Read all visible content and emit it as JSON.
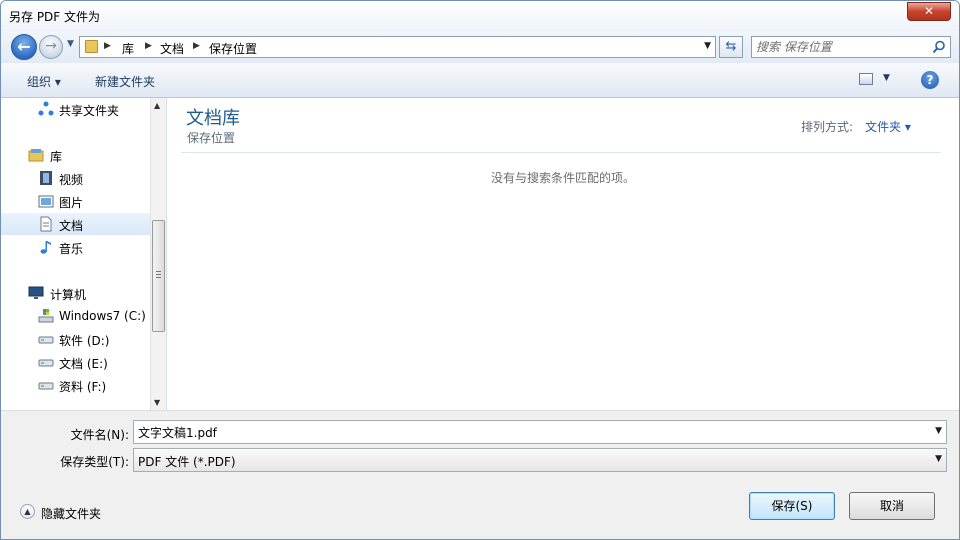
{
  "window": {
    "title": "另存 PDF 文件为",
    "close_label": "✕"
  },
  "nav": {
    "back_icon": "back-arrow-icon",
    "forward_icon": "forward-arrow-icon",
    "breadcrumbs": [
      "库",
      "文档",
      "保存位置"
    ],
    "search_placeholder": "搜索 保存位置"
  },
  "toolbar": {
    "organize": "组织 ▾",
    "new_folder": "新建文件夹",
    "help": "?"
  },
  "sidebar": {
    "items": [
      {
        "label": "共享文件夹",
        "icon": "network-share-icon"
      },
      {
        "label": "库",
        "icon": "library-icon"
      },
      {
        "label": "视频",
        "icon": "video-icon"
      },
      {
        "label": "图片",
        "icon": "picture-icon"
      },
      {
        "label": "文档",
        "icon": "document-icon",
        "selected": true
      },
      {
        "label": "音乐",
        "icon": "music-note-icon"
      },
      {
        "label": "计算机",
        "icon": "computer-icon"
      },
      {
        "label": "Windows7 (C:)",
        "icon": "system-drive-icon"
      },
      {
        "label": "软件 (D:)",
        "icon": "drive-icon"
      },
      {
        "label": "文档 (E:)",
        "icon": "drive-icon"
      },
      {
        "label": "资料 (F:)",
        "icon": "drive-icon"
      }
    ]
  },
  "main": {
    "library_title": "文档库",
    "library_subtitle": "保存位置",
    "arrange_label": "排列方式:",
    "arrange_value": "文件夹 ▾",
    "empty_message": "没有与搜索条件匹配的项。"
  },
  "form": {
    "filename_label": "文件名(N):",
    "filename_value": "文字文稿1.pdf",
    "filetype_label": "保存类型(T):",
    "filetype_value": "PDF 文件 (*.PDF)"
  },
  "footer": {
    "hide_folders": "隐藏文件夹",
    "save_button": "保存(S)",
    "cancel_button": "取消"
  },
  "colors": {
    "accent": "#1e5d8a",
    "link": "#1e5da8",
    "close": "#c7432d"
  }
}
